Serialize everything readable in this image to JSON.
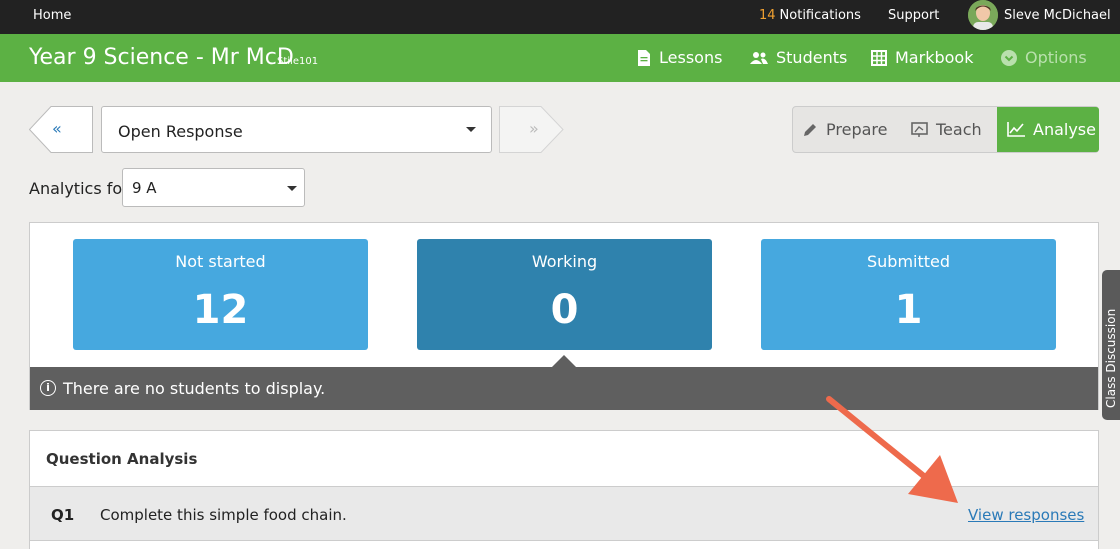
{
  "topbar": {
    "home": "Home",
    "notifications_count": "14",
    "notifications_label": "Notifications",
    "support": "Support",
    "user_name": "Sleve McDichael"
  },
  "header": {
    "title": "Year 9 Science - Mr McD",
    "code": "Stile101",
    "nav": {
      "lessons": "Lessons",
      "students": "Students",
      "markbook": "Markbook",
      "options": "Options"
    }
  },
  "lesson_selector": {
    "prev": "«",
    "next": "»",
    "selected": "Open Response"
  },
  "modes": {
    "prepare": "Prepare",
    "teach": "Teach",
    "analyse": "Analyse"
  },
  "analytics": {
    "label": "Analytics for",
    "class": "9 A"
  },
  "stats": {
    "not_started": {
      "label": "Not started",
      "value": "12"
    },
    "working": {
      "label": "Working",
      "value": "0"
    },
    "submitted": {
      "label": "Submitted",
      "value": "1"
    }
  },
  "message": "There are no students to display.",
  "question_analysis": {
    "title": "Question Analysis",
    "rows": [
      {
        "num": "Q1",
        "text": "Complete this simple food chain.",
        "action": "View responses"
      }
    ]
  },
  "side_tab": "Class Discussion",
  "colors": {
    "brand_green": "#5cb144",
    "stat_blue": "#46a8df",
    "stat_active": "#2f82ad",
    "annotation_arrow": "#ee6a4c"
  }
}
